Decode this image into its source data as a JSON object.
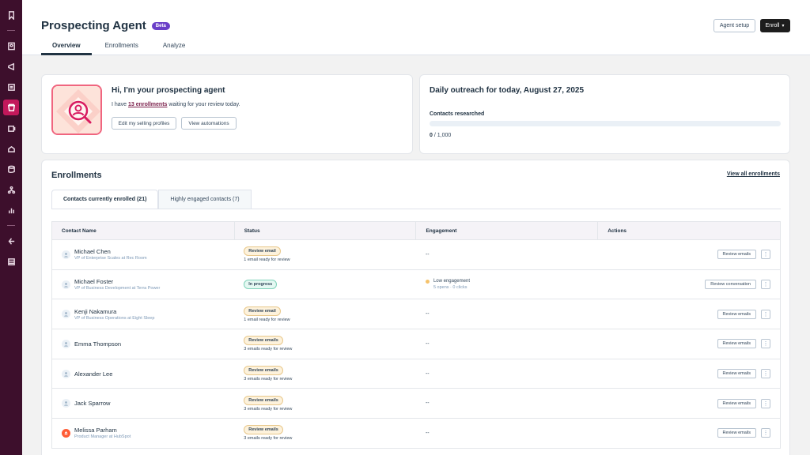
{
  "header": {
    "title": "Prospecting Agent",
    "badge": "Beta",
    "tabs": [
      {
        "label": "Overview"
      },
      {
        "label": "Enrollments"
      },
      {
        "label": "Analyze"
      }
    ],
    "agent_setup_label": "Agent setup",
    "enroll_label": "Enroll"
  },
  "agent_card": {
    "title": "Hi, I'm your prospecting agent",
    "text_before": "I have ",
    "link_text": "13 enrollments",
    "text_after": " waiting for your review today.",
    "edit_profiles_label": "Edit my selling profiles",
    "view_automations_label": "View automations"
  },
  "daily_card": {
    "title": "Daily outreach for today, August 27, 2025",
    "label": "Contacts researched",
    "current": "0",
    "total": " / 1,000",
    "progress_fraction": 0
  },
  "enrollments": {
    "title": "Enrollments",
    "view_all": "View all enrollments",
    "subtabs": [
      {
        "label": "Contacts currently enrolled (21)"
      },
      {
        "label": "Highly engaged contacts (7)"
      }
    ],
    "columns": [
      "Contact Name",
      "Status",
      "Engagement",
      "Actions"
    ],
    "rows": [
      {
        "name": "Michael Chen",
        "title": "VP of Enterprise Scales at Rec Room",
        "status": "Review email",
        "status_sub": "1 email ready for review",
        "engagement": "--",
        "action": "Review emails",
        "kebab": "⋮"
      },
      {
        "name": "Michael Foster",
        "title": "VP of Business Development at Terra Power",
        "status": "In progress",
        "status_sub": "",
        "engagement": "Low engagement",
        "engagement_sub": "5 opens · 0 clicks",
        "action": "Review conversation",
        "kebab": "⋮"
      },
      {
        "name": "Kenji Nakamura",
        "title": "VP of Business Operations at Eight Sleep",
        "status": "Review email",
        "status_sub": "1 email ready for review",
        "engagement": "--",
        "action": "Review emails",
        "kebab": "⋮"
      },
      {
        "name": "Emma Thompson",
        "title": "",
        "status": "Review emails",
        "status_sub": "3 emails ready for review",
        "engagement": "--",
        "action": "Review emails",
        "kebab": "⋮"
      },
      {
        "name": "Alexander Lee",
        "title": "",
        "status": "Review emails",
        "status_sub": "3 emails ready for review",
        "engagement": "--",
        "action": "Review emails",
        "kebab": "⋮"
      },
      {
        "name": "Jack Sparrow",
        "title": "",
        "status": "Review emails",
        "status_sub": "3 emails ready for review",
        "engagement": "--",
        "action": "Review emails",
        "kebab": "⋮"
      },
      {
        "name": "Melissa Parham",
        "title": "Product Manager at HubSpot",
        "status": "Review emails",
        "status_sub": "3 emails ready for review",
        "engagement": "--",
        "action": "Review emails",
        "kebab": "⋮"
      }
    ]
  },
  "colors": {
    "sidebar": "#3d0f2c",
    "sidebar_active": "#c2185b",
    "accent": "#7a1e4a",
    "beta": "#6a3fc8"
  }
}
